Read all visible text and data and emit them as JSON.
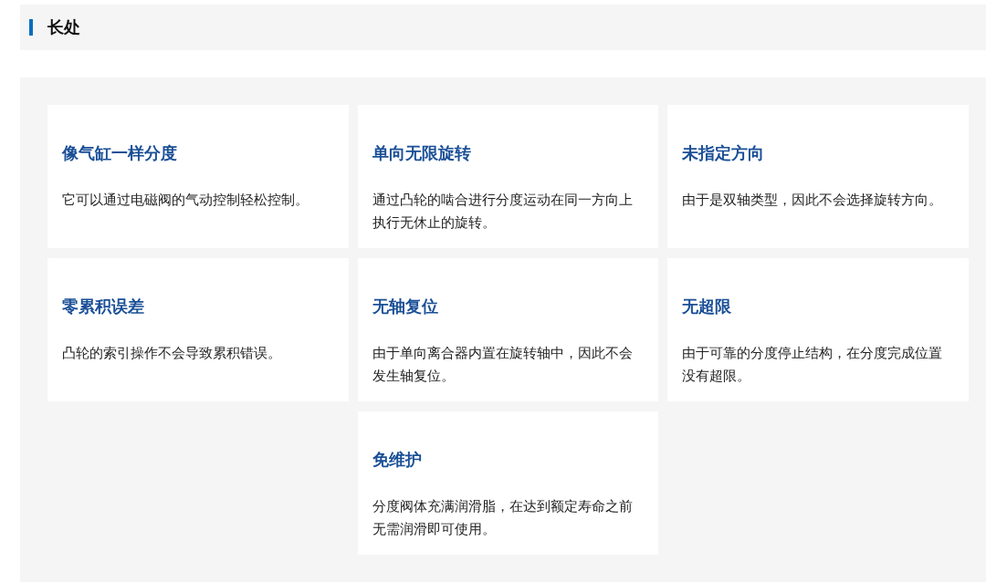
{
  "section": {
    "title": "长处"
  },
  "features": [
    {
      "title": "像气缸一样分度",
      "description": "它可以通过电磁阀的气动控制轻松控制。"
    },
    {
      "title": "单向无限旋转",
      "description": "通过凸轮的啮合进行分度运动在同一方向上执行无休止的旋转。"
    },
    {
      "title": "未指定方向",
      "description": "由于是双轴类型，因此不会选择旋转方向。"
    },
    {
      "title": "零累积误差",
      "description": "凸轮的索引操作不会导致累积错误。"
    },
    {
      "title": "无轴复位",
      "description": "由于单向离合器内置在旋转轴中，因此不会发生轴复位。"
    },
    {
      "title": "无超限",
      "description": "由于可靠的分度停止结构，在分度完成位置没有超限。"
    },
    {
      "title": "免维护",
      "description": "分度阀体充满润滑脂，在达到额定寿命之前无需润滑即可使用。"
    }
  ]
}
